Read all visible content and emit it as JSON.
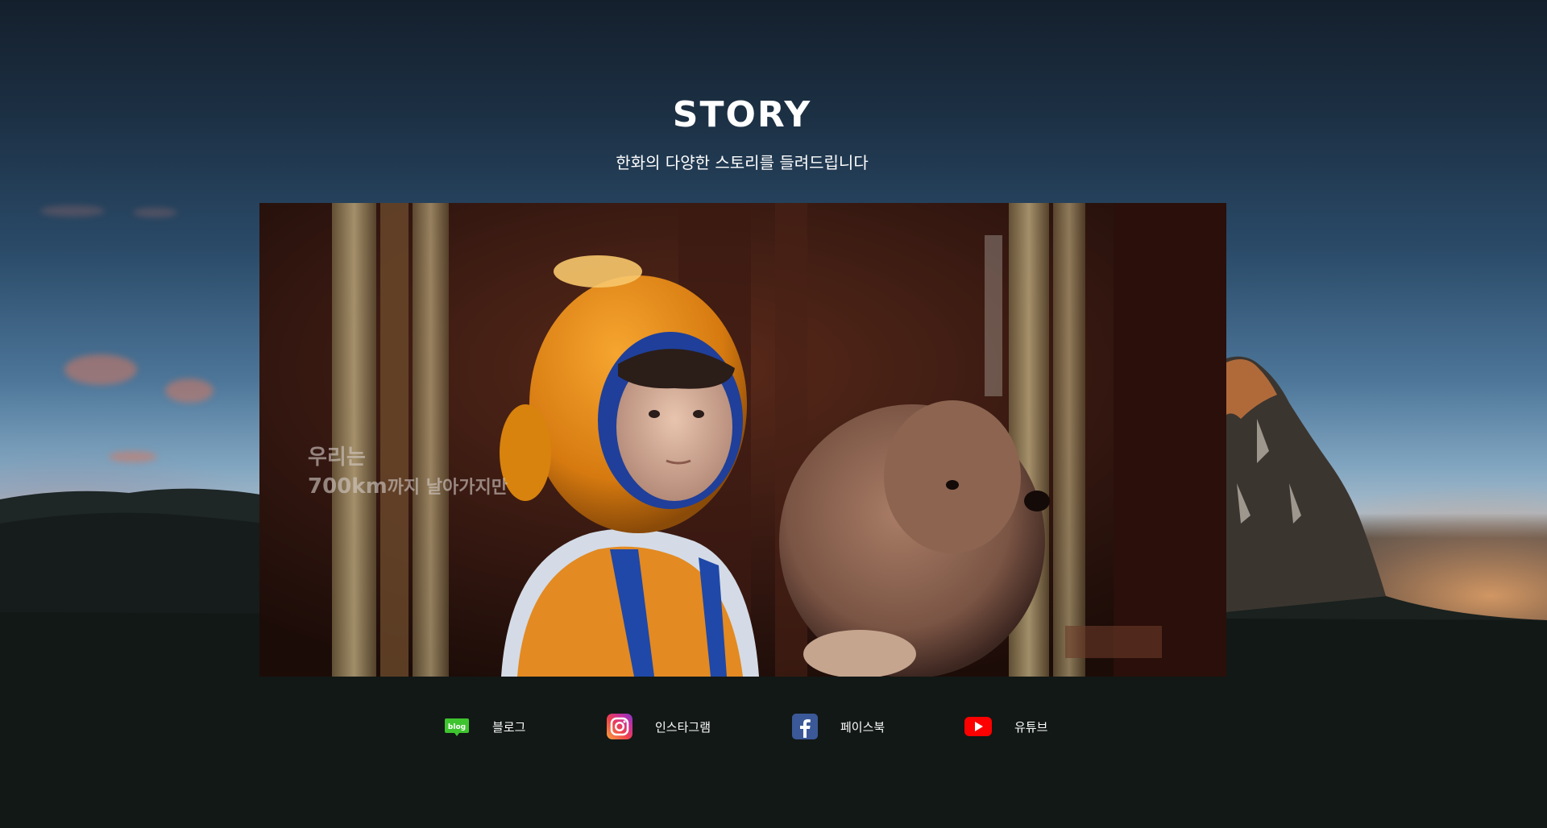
{
  "section": {
    "title": "STORY",
    "subtitle": "한화의 다양한 스토리를 들려드립니다"
  },
  "video": {
    "caption_line1": "우리는",
    "caption_line2_number": "700km",
    "caption_line2_rest": "까지 날아가지만"
  },
  "social_links": [
    {
      "label": "블로그",
      "icon": "blog-icon",
      "icon_text": "blog",
      "color": "#3ec42f"
    },
    {
      "label": "인스타그램",
      "icon": "instagram-icon",
      "color": "#d6249f"
    },
    {
      "label": "페이스북",
      "icon": "facebook-icon",
      "color": "#3b5998"
    },
    {
      "label": "유튜브",
      "icon": "youtube-icon",
      "color": "#ff0000"
    }
  ]
}
